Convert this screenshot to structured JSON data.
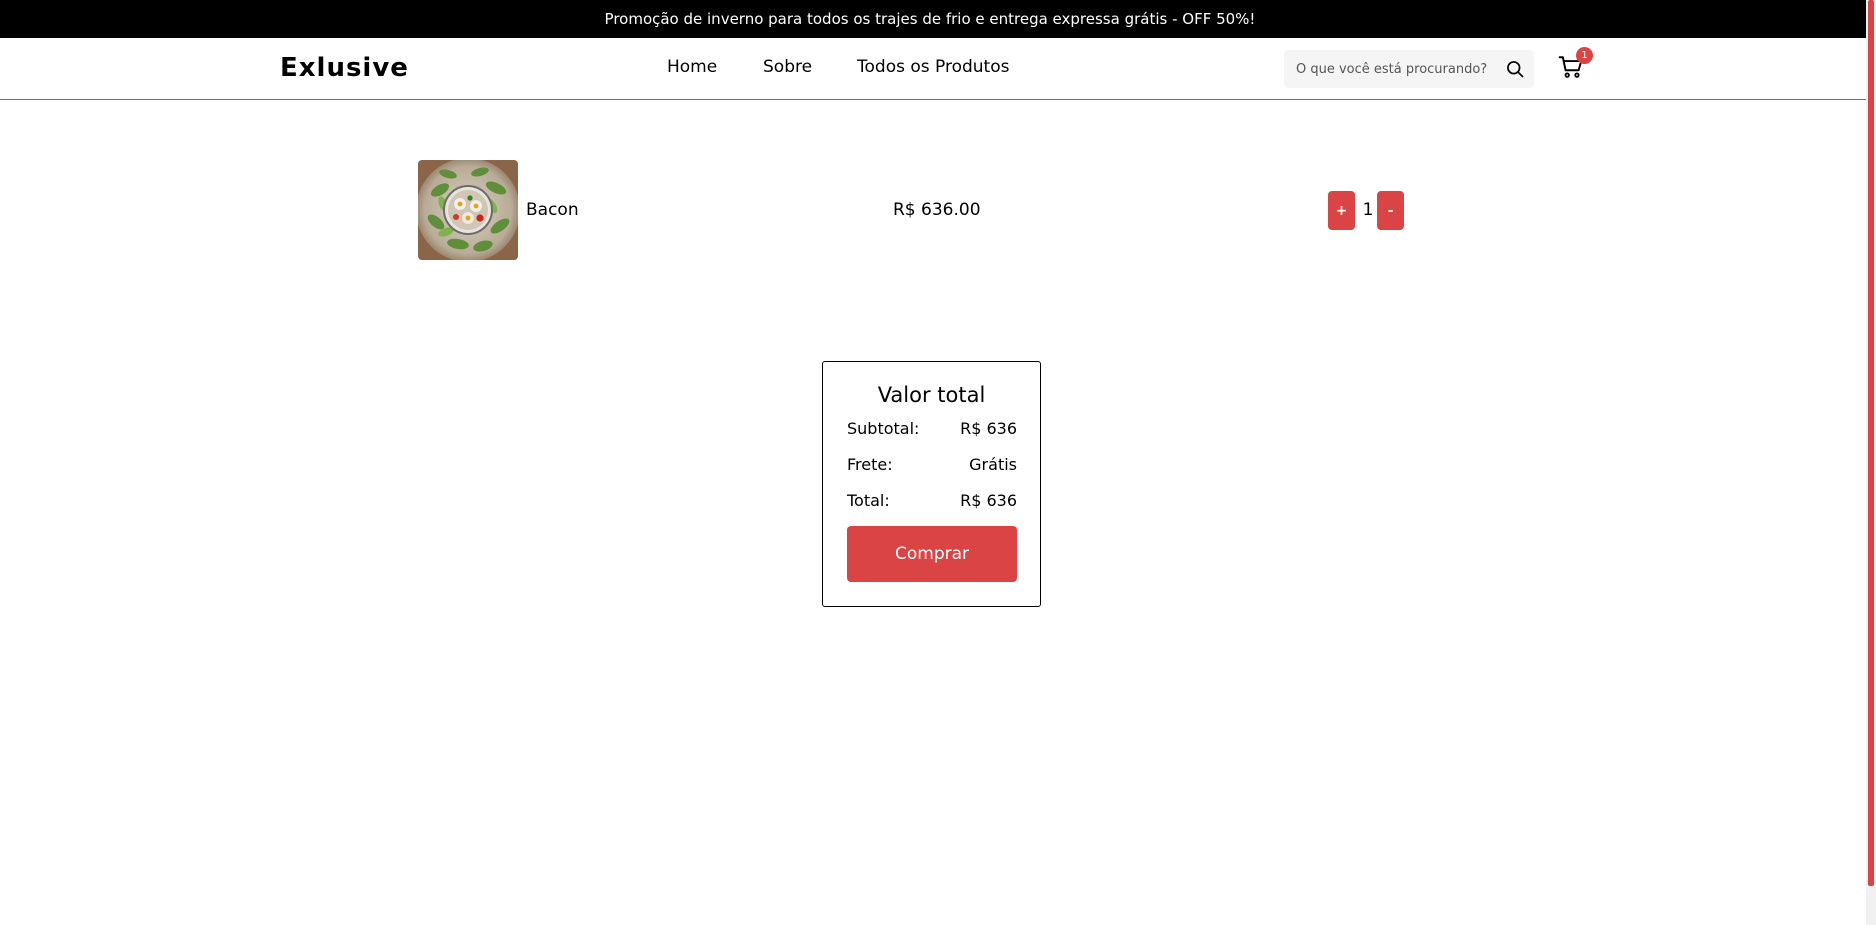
{
  "colors": {
    "accent": "#DB4444",
    "promo_background": "#000000",
    "promo_text": "#FFFFFF",
    "search_background": "#F5F5F5"
  },
  "promo": {
    "text": "Promoção de inverno para todos os trajes de frio e entrega expressa grátis - OFF 50%!"
  },
  "header": {
    "logo": "Exlusive",
    "nav": [
      {
        "label": "Home"
      },
      {
        "label": "Sobre"
      },
      {
        "label": "Todos os Produtos"
      }
    ],
    "search": {
      "placeholder": "O que você está procurando?",
      "icon": "search-icon"
    },
    "cart": {
      "icon": "cart-icon",
      "count": "1"
    }
  },
  "cart": {
    "items": [
      {
        "name": "Bacon",
        "price": "R$ 636.00",
        "quantity": "1",
        "increment_label": "+",
        "decrement_label": "-",
        "image": "salad-bowl-photo"
      }
    ]
  },
  "summary": {
    "title": "Valor total",
    "subtotal_label": "Subtotal:",
    "subtotal_value": "R$ 636",
    "shipping_label": "Frete:",
    "shipping_value": "Grátis",
    "total_label": "Total:",
    "total_value": "R$ 636",
    "buy_label": "Comprar"
  }
}
